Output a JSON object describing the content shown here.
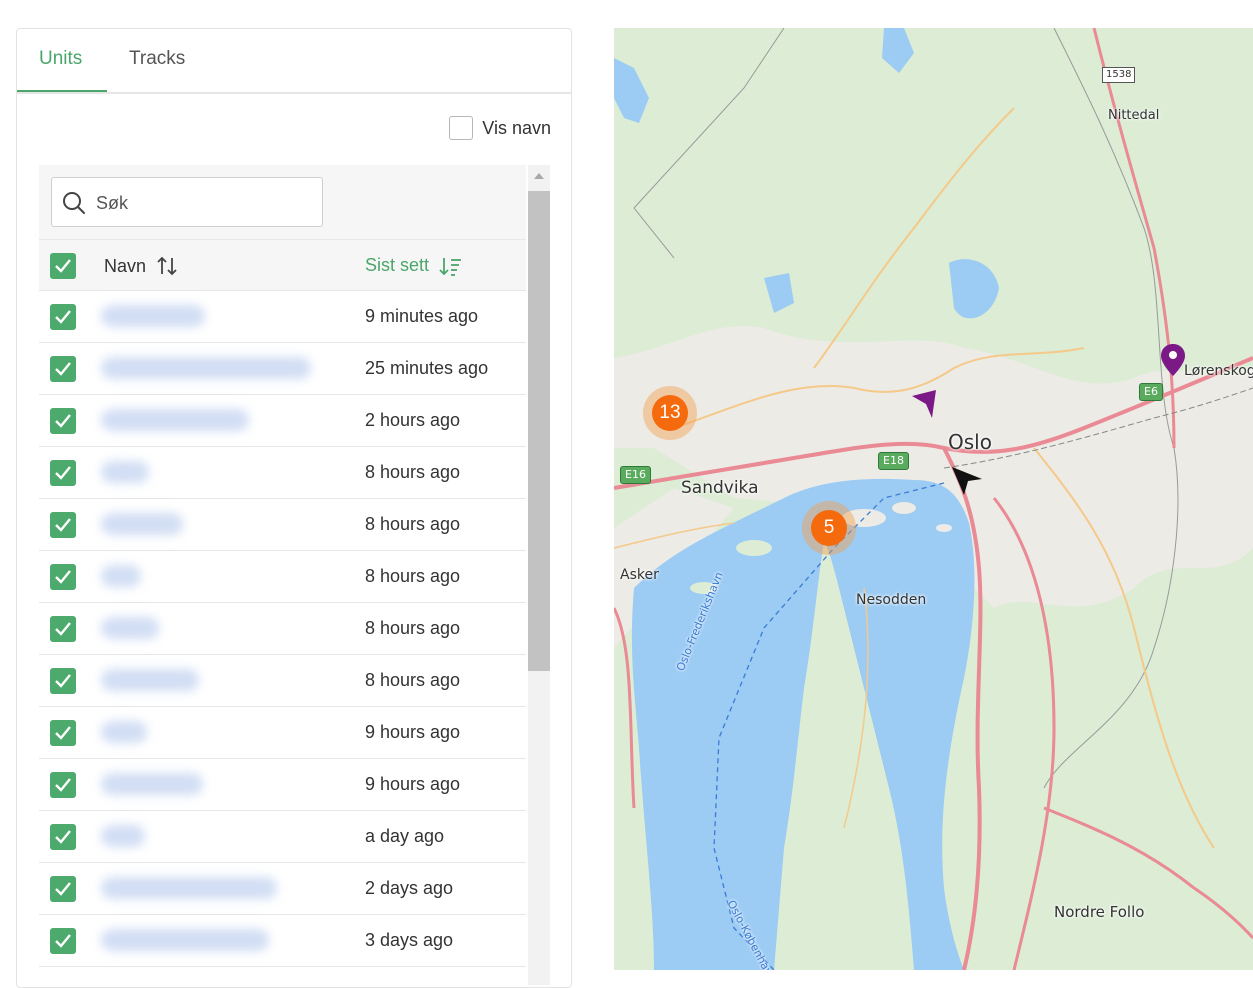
{
  "tabs": [
    {
      "label": "Units",
      "active": true
    },
    {
      "label": "Tracks",
      "active": false
    }
  ],
  "vis_navn": {
    "label": "Vis navn",
    "checked": false
  },
  "search": {
    "placeholder": "Søk",
    "value": ""
  },
  "table": {
    "columns": {
      "name": "Navn",
      "last_seen": "Sist sett"
    },
    "select_all_checked": true,
    "rows": [
      {
        "name": "",
        "last_seen": "9 minutes ago",
        "checked": true
      },
      {
        "name": "",
        "last_seen": "25 minutes ago",
        "checked": true
      },
      {
        "name": "",
        "last_seen": "2 hours ago",
        "checked": true
      },
      {
        "name": "",
        "last_seen": "8 hours ago",
        "checked": true
      },
      {
        "name": "",
        "last_seen": "8 hours ago",
        "checked": true
      },
      {
        "name": "",
        "last_seen": "8 hours ago",
        "checked": true
      },
      {
        "name": "",
        "last_seen": "8 hours ago",
        "checked": true
      },
      {
        "name": "",
        "last_seen": "8 hours ago",
        "checked": true
      },
      {
        "name": "",
        "last_seen": "9 hours ago",
        "checked": true
      },
      {
        "name": "",
        "last_seen": "9 hours ago",
        "checked": true
      },
      {
        "name": "",
        "last_seen": "a day ago",
        "checked": true
      },
      {
        "name": "",
        "last_seen": "2 days ago",
        "checked": true
      },
      {
        "name": "",
        "last_seen": "3 days ago",
        "checked": true
      }
    ]
  },
  "map": {
    "places": {
      "oslo": "Oslo",
      "sandvika": "Sandvika",
      "asker": "Asker",
      "nesodden": "Nesodden",
      "nittedal": "Nittedal",
      "lorenskog": "Lørenskog",
      "nordre_follo": "Nordre Follo",
      "fjord_route_1": "Oslo-Frederikshavn",
      "fjord_route_2": "Oslo-København"
    },
    "road_shields": {
      "e16": "E16",
      "e18": "E18",
      "e6": "E6",
      "r1538": "1538"
    },
    "clusters": [
      {
        "count": "13"
      },
      {
        "count": "5"
      }
    ],
    "colors": {
      "cluster": "#f46a0c",
      "marker_purple": "#7b1a86",
      "water": "#9ccbf3",
      "land": "#dcecd5"
    }
  },
  "colors": {
    "accent_green": "#4aa66a",
    "checkbox_green": "#4caa6c"
  }
}
